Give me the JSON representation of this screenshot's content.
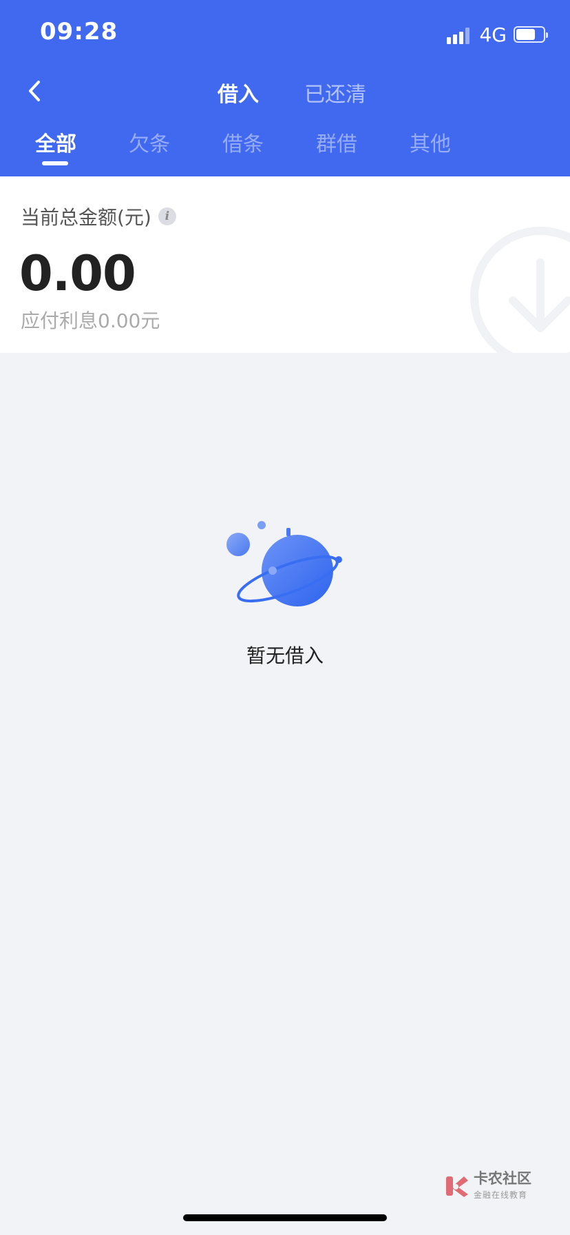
{
  "status_bar": {
    "time": "09:28",
    "network": "4G",
    "battery_level": 0.7,
    "signal_bars_active": 3,
    "signal_bars_total": 4
  },
  "nav": {
    "back_icon": "chevron-left-icon",
    "top_tabs": [
      {
        "label": "借入",
        "active": true
      },
      {
        "label": "已还清",
        "active": false
      }
    ],
    "sub_tabs": [
      {
        "label": "全部",
        "active": true
      },
      {
        "label": "欠条",
        "active": false
      },
      {
        "label": "借条",
        "active": false
      },
      {
        "label": "群借",
        "active": false
      },
      {
        "label": "其他",
        "active": false
      }
    ]
  },
  "summary": {
    "label": "当前总金额(元)",
    "info_icon": "i",
    "total_amount": "0.00",
    "interest": "应付利息0.00元"
  },
  "empty_state": {
    "illustration": "planet-icon",
    "text": "暂无借入"
  },
  "brand": {
    "name": "卡农社区",
    "tagline": "金融在线教育"
  },
  "colors": {
    "header_bg": "#4169f0",
    "page_bg": "#f2f3f7",
    "planet": "#3a6ef2"
  }
}
